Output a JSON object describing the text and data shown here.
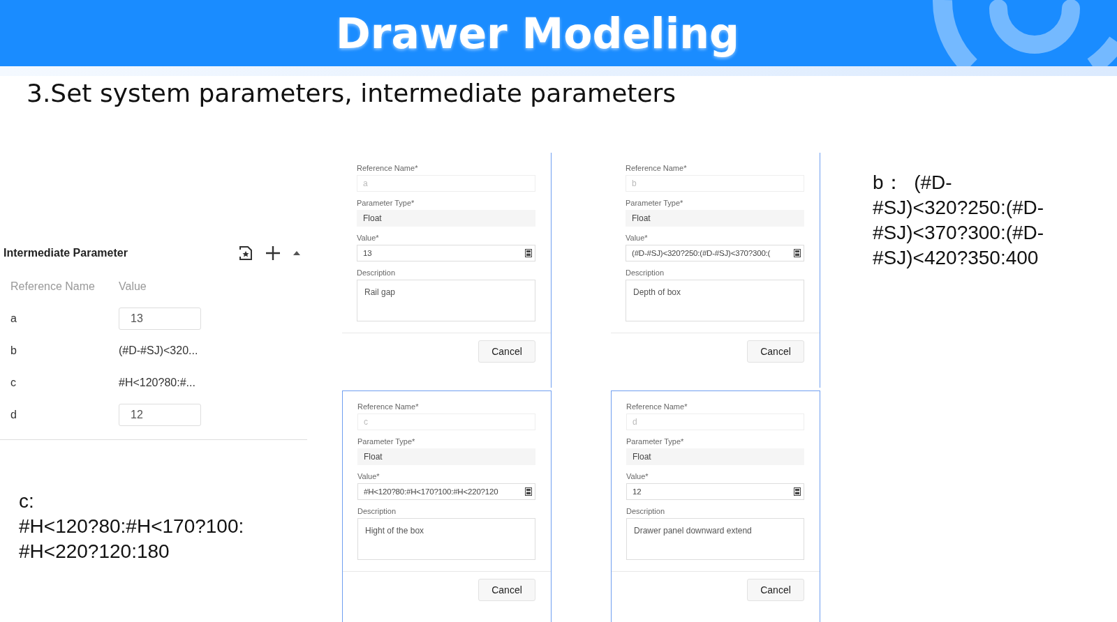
{
  "banner": {
    "title": "Drawer Modeling"
  },
  "subtitle": "3.Set system parameters, intermediate parameters",
  "panel": {
    "title": "Intermediate Parameter",
    "columns": [
      "Reference Name",
      "Value"
    ],
    "rows": [
      {
        "name": "a",
        "value": "13",
        "kind": "input"
      },
      {
        "name": "b",
        "value": "(#D-#SJ)<320...",
        "kind": "text"
      },
      {
        "name": "c",
        "value": "#H<120?80:#...",
        "kind": "text"
      },
      {
        "name": "d",
        "value": "12",
        "kind": "input"
      }
    ]
  },
  "note_c": "c:\n#H<120?80:#H<170?100:\n#H<220?120:180",
  "note_b": "b：  (#D-\n#SJ)<320?250:(#D-\n#SJ)<370?300:(#D-\n#SJ)<420?350:400",
  "dialogs": [
    {
      "name_label": "Reference Name*",
      "name": "a",
      "type_label": "Parameter Type*",
      "type": "Float",
      "value_label": "Value*",
      "value": "13",
      "description_label": "Description",
      "description": "Rail gap",
      "button": "Cancel"
    },
    {
      "name_label": "Reference Name*",
      "name": "b",
      "type_label": "Parameter Type*",
      "type": "Float",
      "value_label": "Value*",
      "value": "(#D-#SJ)<320?250:(#D-#SJ)<370?300:(",
      "description_label": "Description",
      "description": "Depth of box",
      "button": "Cancel"
    },
    {
      "name_label": "Reference Name*",
      "name": "c",
      "type_label": "Parameter Type*",
      "type": "Float",
      "value_label": "Value*",
      "value": "#H<120?80:#H<170?100:#H<220?120",
      "description_label": "Description",
      "description": "Hight of the box",
      "button": "Cancel"
    },
    {
      "name_label": "Reference Name*",
      "name": "d",
      "type_label": "Parameter Type*",
      "type": "Float",
      "value_label": "Value*",
      "value": "12",
      "description_label": "Description",
      "description": "Drawer panel downward extend",
      "button": "Cancel"
    }
  ]
}
